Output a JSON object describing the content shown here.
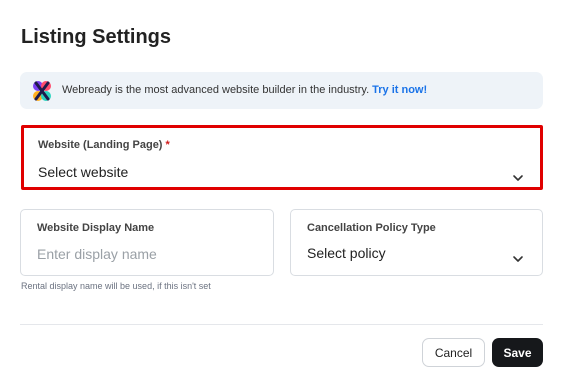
{
  "page": {
    "title": "Listing Settings"
  },
  "banner": {
    "logo_icon": "webready-logo",
    "text": "Webready is the most advanced website builder in the industry.",
    "link_label": "Try it now!",
    "link_color": "#1a73e8"
  },
  "fields": {
    "website": {
      "label": "Website (Landing Page)",
      "required_mark": "*",
      "value": "Select website",
      "icon": "chevron-down-icon",
      "highlight_color": "#e00000"
    },
    "display_name": {
      "label": "Website Display Name",
      "placeholder": "Enter display name",
      "hint": "Rental display name will be used, if this isn't set"
    },
    "cancellation_policy": {
      "label": "Cancellation Policy Type",
      "value": "Select policy",
      "icon": "chevron-down-icon"
    }
  },
  "actions": {
    "cancel_label": "Cancel",
    "save_label": "Save",
    "save_color": "#16181b"
  }
}
